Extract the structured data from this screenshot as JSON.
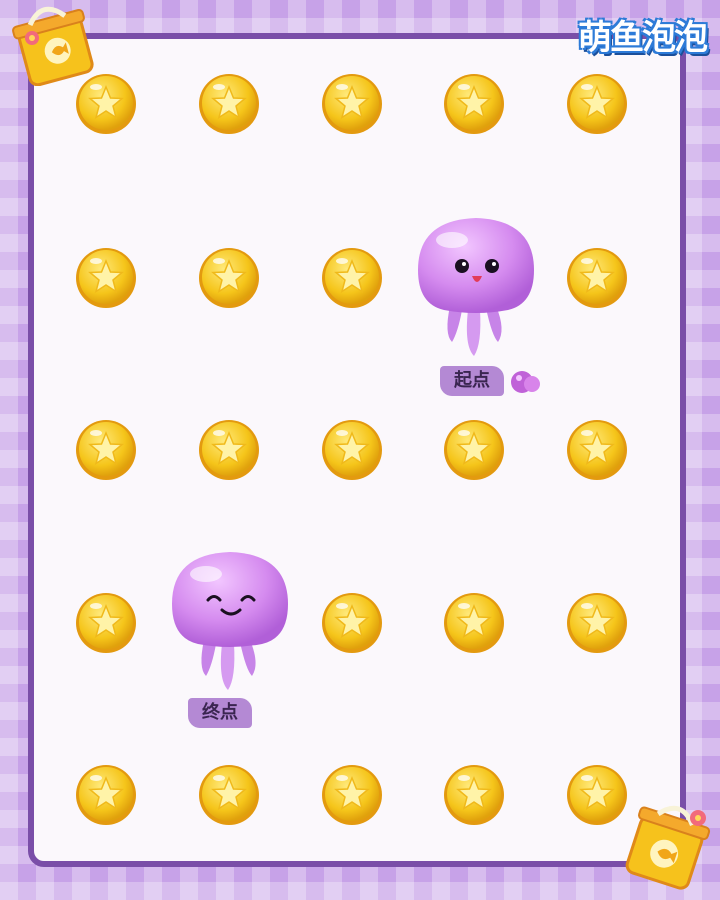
{
  "game": {
    "logo_text": "萌鱼泡泡",
    "start_label": "起点",
    "end_label": "终点"
  },
  "grid": {
    "rows": 5,
    "cols": 5
  },
  "coins": [
    {
      "row": 0,
      "col": 0
    },
    {
      "row": 0,
      "col": 1
    },
    {
      "row": 0,
      "col": 2
    },
    {
      "row": 0,
      "col": 3
    },
    {
      "row": 0,
      "col": 4
    },
    {
      "row": 1,
      "col": 0
    },
    {
      "row": 1,
      "col": 1
    },
    {
      "row": 1,
      "col": 2
    },
    {
      "row": 1,
      "col": 4
    },
    {
      "row": 2,
      "col": 0
    },
    {
      "row": 2,
      "col": 1
    },
    {
      "row": 2,
      "col": 2
    },
    {
      "row": 2,
      "col": 3
    },
    {
      "row": 2,
      "col": 4
    },
    {
      "row": 3,
      "col": 0
    },
    {
      "row": 3,
      "col": 2
    },
    {
      "row": 3,
      "col": 3
    },
    {
      "row": 3,
      "col": 4
    },
    {
      "row": 4,
      "col": 0
    },
    {
      "row": 4,
      "col": 1
    },
    {
      "row": 4,
      "col": 2
    },
    {
      "row": 4,
      "col": 3
    },
    {
      "row": 4,
      "col": 4
    }
  ],
  "start_jellyfish": {
    "row": 1,
    "col": 3,
    "expression": "surprised"
  },
  "end_jellyfish": {
    "row": 3,
    "col": 1,
    "expression": "happy"
  },
  "colors": {
    "coin": "#f5c51a",
    "jelly": "#d58bef",
    "tag": "#b489d4",
    "frame": "#7a4ea8"
  },
  "icons": [
    "coin-star-icon",
    "purple-shell-icon",
    "shopping-bag-icon",
    "fish-icon",
    "flower-icon"
  ]
}
